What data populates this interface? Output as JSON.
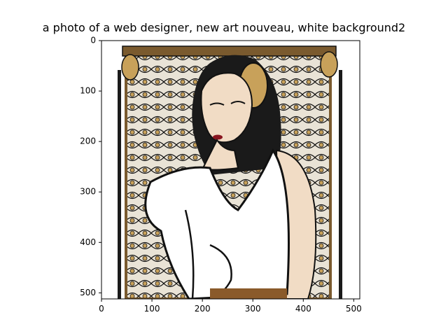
{
  "title": "a photo of a web designer, new art nouveau, white background2",
  "axes": {
    "x_ticks": [
      {
        "value": 0,
        "label": "0"
      },
      {
        "value": 100,
        "label": "100"
      },
      {
        "value": 200,
        "label": "200"
      },
      {
        "value": 300,
        "label": "300"
      },
      {
        "value": 400,
        "label": "400"
      },
      {
        "value": 500,
        "label": "500"
      }
    ],
    "y_ticks": [
      {
        "value": 0,
        "label": "0"
      },
      {
        "value": 100,
        "label": "100"
      },
      {
        "value": 200,
        "label": "200"
      },
      {
        "value": 300,
        "label": "300"
      },
      {
        "value": 400,
        "label": "400"
      },
      {
        "value": 500,
        "label": "500"
      }
    ],
    "x_range": [
      0,
      512
    ],
    "y_range": [
      512,
      0
    ]
  },
  "colors": {
    "gold": "#c8a15a",
    "bronze": "#7a5a2e",
    "ink": "#111111",
    "skin": "#f1dcc5",
    "dress": "#ffffff",
    "hair": "#1a1a1a",
    "lips": "#8a1620"
  }
}
